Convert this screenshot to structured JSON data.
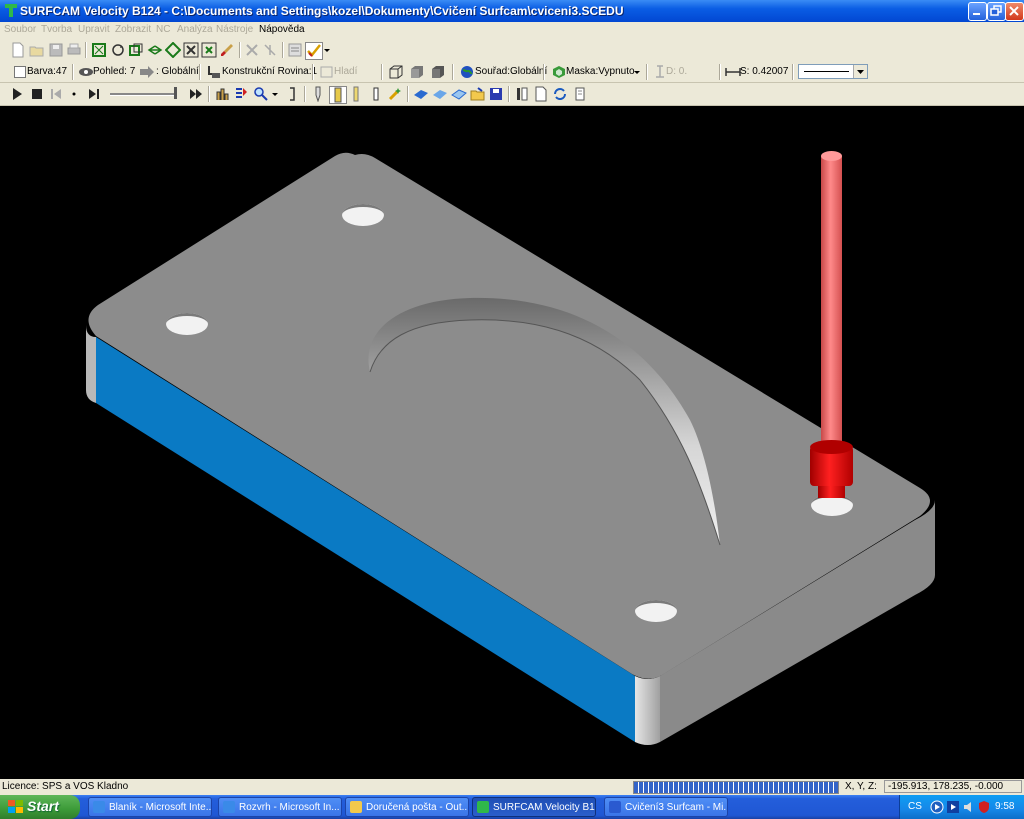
{
  "window": {
    "title": "SURFCAM Velocity B124 - C:\\Documents and Settings\\kozel\\Dokumenty\\Cvičení Surfcam\\cviceni3.SCEDU"
  },
  "menu": [
    "Soubor",
    "Tvorba",
    "Upravit",
    "Zobrazit",
    "NC",
    "Analýza",
    "Nástroje",
    "Nápověda"
  ],
  "toolbar2": {
    "color": "Barva:47",
    "view": "Pohled: 7",
    "view_coord": ": Globální",
    "construction_plane": "Konstrukční Rovina:1",
    "smooth": "Hladí",
    "coord_system": "Souřad:Globální",
    "mask": "Maska:Vypnuto",
    "depth": "D: 0.",
    "step": "S: 0.42007"
  },
  "status": {
    "license": "Licence: SPS a VOS Kladno",
    "progress_fraction": 1.0,
    "xyz_label": "X, Y, Z:",
    "xyz_value": "-195.913, 178.235, -0.000"
  },
  "taskbar": {
    "start": "Start",
    "tasks": [
      {
        "label": "Blaník - Microsoft Inte...",
        "icon": "ie-icon",
        "active": false
      },
      {
        "label": "Rozvrh - Microsoft In...",
        "icon": "ie-icon",
        "active": false
      },
      {
        "label": "Doručená pošta - Out...",
        "icon": "outlook-icon",
        "active": false
      },
      {
        "label": "SURFCAM Velocity B1...",
        "icon": "surfcam-icon",
        "active": true
      },
      {
        "label": "Cvičení3 Surfcam - Mi...",
        "icon": "word-icon",
        "active": false
      }
    ],
    "language": "CS",
    "clock": "9:58"
  },
  "colors": {
    "part_top": "#8c8c8c",
    "part_side_blue": "#0a7ac4",
    "tool_shank": "#f06e6e",
    "tool_holder": "#e01010"
  }
}
